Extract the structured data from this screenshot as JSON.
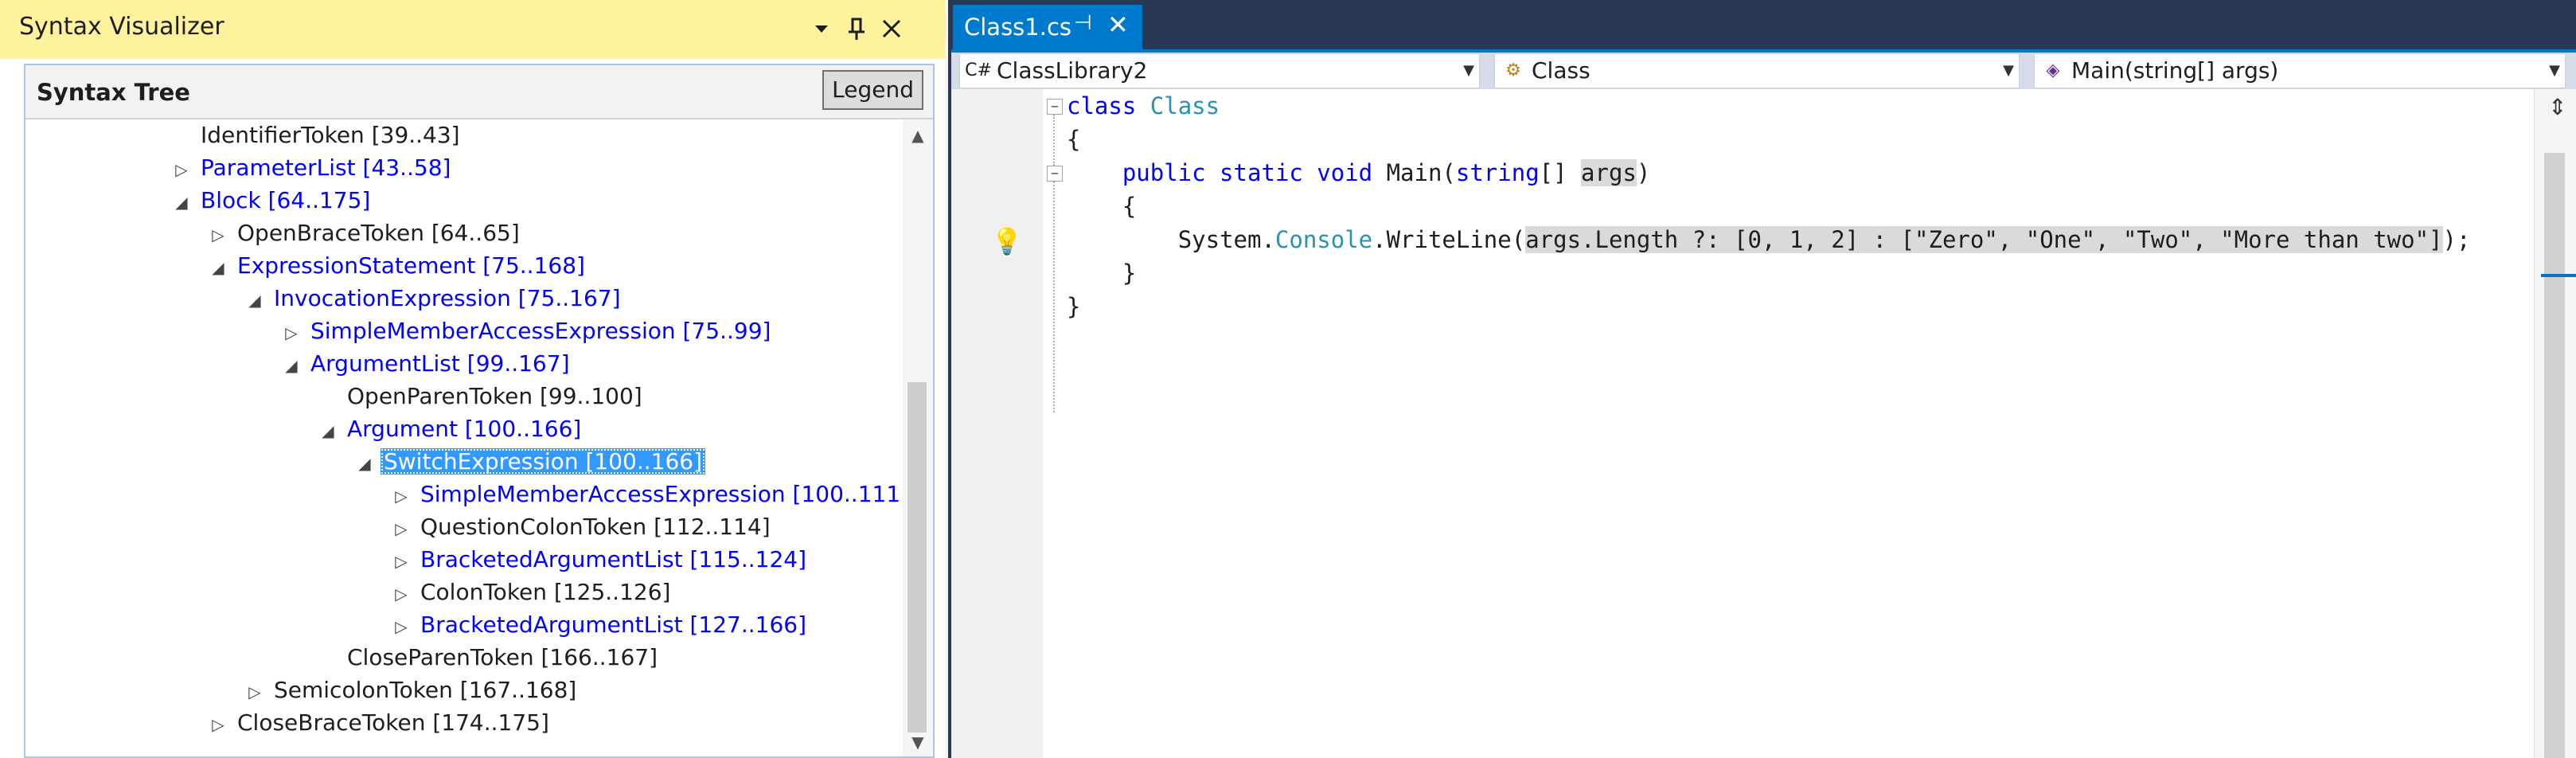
{
  "tool_window": {
    "title": "Syntax Visualizer",
    "panel_title": "Syntax Tree",
    "legend_label": "Legend",
    "icons": [
      "dropdown-icon",
      "pin-icon",
      "close-icon"
    ]
  },
  "tree": [
    {
      "label": "IdentifierToken [39..43]",
      "indent": 1,
      "expander": "none",
      "kind": "token"
    },
    {
      "label": "ParameterList [43..58]",
      "indent": 1,
      "expander": "collapsed",
      "kind": "node"
    },
    {
      "label": "Block [64..175]",
      "indent": 1,
      "expander": "expanded",
      "kind": "node"
    },
    {
      "label": "OpenBraceToken [64..65]",
      "indent": 2,
      "expander": "collapsed",
      "kind": "token"
    },
    {
      "label": "ExpressionStatement [75..168]",
      "indent": 2,
      "expander": "expanded",
      "kind": "node"
    },
    {
      "label": "InvocationExpression [75..167]",
      "indent": 3,
      "expander": "expanded",
      "kind": "node"
    },
    {
      "label": "SimpleMemberAccessExpression [75..99]",
      "indent": 4,
      "expander": "collapsed",
      "kind": "node"
    },
    {
      "label": "ArgumentList [99..167]",
      "indent": 4,
      "expander": "expanded",
      "kind": "node"
    },
    {
      "label": "OpenParenToken [99..100]",
      "indent": 5,
      "expander": "none",
      "kind": "token"
    },
    {
      "label": "Argument [100..166]",
      "indent": 5,
      "expander": "expanded",
      "kind": "node"
    },
    {
      "label": "SwitchExpression [100..166]",
      "indent": 6,
      "expander": "expanded",
      "kind": "node",
      "selected": true
    },
    {
      "label": "SimpleMemberAccessExpression [100..111]",
      "indent": 7,
      "expander": "collapsed",
      "kind": "node"
    },
    {
      "label": "QuestionColonToken [112..114]",
      "indent": 7,
      "expander": "collapsed",
      "kind": "token"
    },
    {
      "label": "BracketedArgumentList [115..124]",
      "indent": 7,
      "expander": "collapsed",
      "kind": "node"
    },
    {
      "label": "ColonToken [125..126]",
      "indent": 7,
      "expander": "collapsed",
      "kind": "token"
    },
    {
      "label": "BracketedArgumentList [127..166]",
      "indent": 7,
      "expander": "collapsed",
      "kind": "node"
    },
    {
      "label": "CloseParenToken [166..167]",
      "indent": 5,
      "expander": "none",
      "kind": "token"
    },
    {
      "label": "SemicolonToken [167..168]",
      "indent": 3,
      "expander": "collapsed",
      "kind": "token"
    },
    {
      "label": "CloseBraceToken [174..175]",
      "indent": 2,
      "expander": "collapsed",
      "kind": "token"
    }
  ],
  "editor": {
    "tab": {
      "name": "Class1.cs"
    },
    "nav": {
      "project": "ClassLibrary2",
      "type": "Class",
      "member": "Main(string[] args)"
    },
    "code": {
      "l1_kw": "class",
      "l1_ty": "Class",
      "l2": "{",
      "l3_a": "public static void",
      "l3_b": " Main(",
      "l3_c": "string",
      "l3_d": "[] ",
      "l3_e": "args",
      "l3_f": ")",
      "l4": "{",
      "l5_a": "System.",
      "l5_b": "Console",
      "l5_c": ".WriteLine(",
      "l5_d": "args.Length ?: [0, 1, 2] : [\"Zero\", \"One\", \"Two\", \"More than two\"]",
      "l5_e": ");",
      "l6": "}",
      "l7": "}"
    }
  },
  "colors": {
    "title_bar": "#fff29d",
    "tab_accent": "#007acc",
    "node_blue": "#0000ff",
    "selection": "#3399ff",
    "keyword": "#0000ff",
    "type": "#2b91af"
  }
}
